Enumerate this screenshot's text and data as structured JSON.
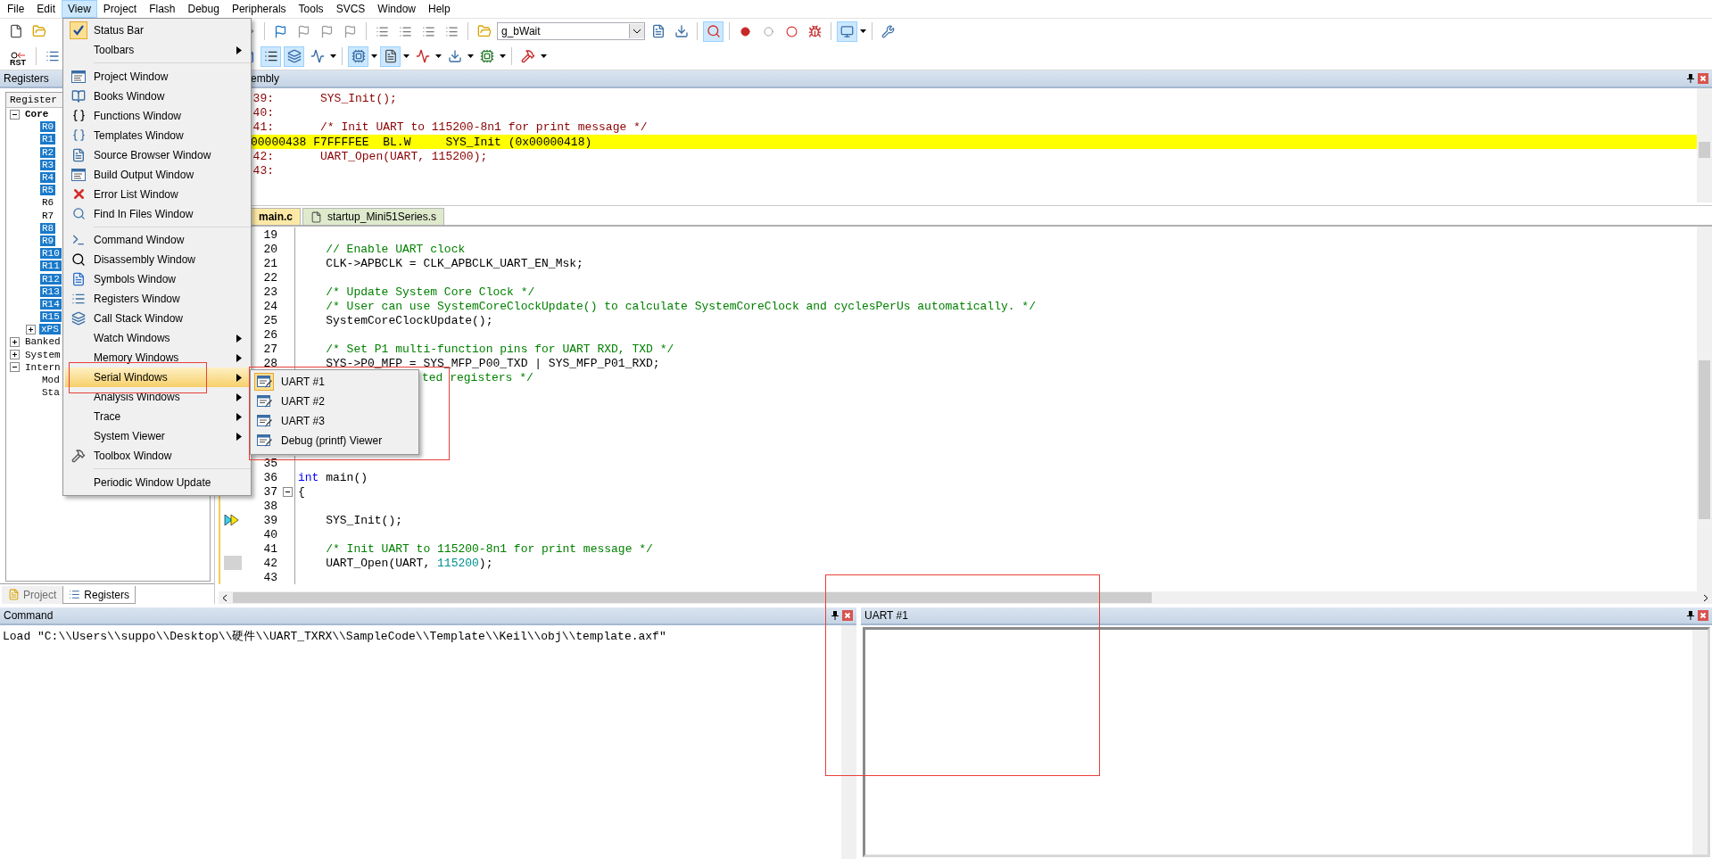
{
  "menubar": [
    {
      "label": "File",
      "selected": false
    },
    {
      "label": "Edit",
      "selected": false
    },
    {
      "label": "View",
      "selected": true
    },
    {
      "label": "Project",
      "selected": false
    },
    {
      "label": "Flash",
      "selected": false
    },
    {
      "label": "Debug",
      "selected": false
    },
    {
      "label": "Peripherals",
      "selected": false
    },
    {
      "label": "Tools",
      "selected": false
    },
    {
      "label": "SVCS",
      "selected": false
    },
    {
      "label": "Window",
      "selected": false
    },
    {
      "label": "Help",
      "selected": false
    }
  ],
  "toolbar": {
    "reset_label": "RST",
    "combo_value": "g_bWait"
  },
  "registers_panel": {
    "title": "Registers",
    "column": "Register",
    "tree": [
      {
        "label": "Core",
        "expanded": true,
        "children": [
          {
            "label": "R0",
            "selected": true
          },
          {
            "label": "R1",
            "selected": true
          },
          {
            "label": "R2",
            "selected": true
          },
          {
            "label": "R3",
            "selected": true
          },
          {
            "label": "R4",
            "selected": true
          },
          {
            "label": "R5",
            "selected": true
          },
          {
            "label": "R6",
            "selected": false
          },
          {
            "label": "R7",
            "selected": false
          },
          {
            "label": "R8",
            "selected": true
          },
          {
            "label": "R9",
            "selected": true
          },
          {
            "label": "R10",
            "selected": true
          },
          {
            "label": "R11",
            "selected": true
          },
          {
            "label": "R12",
            "selected": true
          },
          {
            "label": "R13",
            "selected": true
          },
          {
            "label": "R14",
            "selected": true
          },
          {
            "label": "R15",
            "selected": true
          },
          {
            "label": "xPS",
            "selected": true,
            "expanded": false
          }
        ]
      },
      {
        "label": "Banked",
        "expanded": false
      },
      {
        "label": "System",
        "expanded": false
      },
      {
        "label": "Intern",
        "expanded": true,
        "children": [
          {
            "label": "Mod",
            "selected": false
          },
          {
            "label": "Sta",
            "selected": false
          }
        ]
      }
    ],
    "tabs": [
      {
        "label": "Project",
        "selected": false
      },
      {
        "label": "Registers",
        "selected": true
      }
    ]
  },
  "disassembly": {
    "title": "embly",
    "lines": [
      {
        "kind": "source",
        "number": "39:",
        "text": "SYS_Init();",
        "current": false
      },
      {
        "kind": "source",
        "number": "40:",
        "current": false
      },
      {
        "kind": "source",
        "number": "41:",
        "text": "/* Init UART to 115200-8n1 for print message */",
        "current": false
      },
      {
        "kind": "instruction",
        "text": "00000438 F7FFFFEE  BL.W     SYS_Init (0x00000418)",
        "current": true
      },
      {
        "kind": "source",
        "number": "42:",
        "text": "UART_Open(UART, 115200);",
        "current": false
      },
      {
        "kind": "source",
        "number": "43:",
        "current": false
      }
    ]
  },
  "editor": {
    "tabs": [
      {
        "label": "main.c",
        "selected": true
      },
      {
        "label": "startup_Mini51Series.s",
        "selected": false
      }
    ],
    "lines": [
      {
        "kind": "blank",
        "number": "19"
      },
      {
        "kind": "comment",
        "number": "20",
        "text": "    // Enable UART clock"
      },
      {
        "kind": "code",
        "number": "21",
        "text": "    CLK->APBCLK = CLK_APBCLK_UART_EN_Msk;"
      },
      {
        "kind": "blank",
        "number": "22"
      },
      {
        "kind": "comment",
        "number": "23",
        "text": "    /* Update System Core Clock */"
      },
      {
        "kind": "comment",
        "number": "24",
        "text": "    /* User can use SystemCoreClockUpdate() to calculate SystemCoreClock and cyclesPerUs automatically. */"
      },
      {
        "kind": "code",
        "number": "25",
        "text": "    SystemCoreClockUpdate();"
      },
      {
        "kind": "blank",
        "number": "26"
      },
      {
        "kind": "comment",
        "number": "27",
        "text": "    /* Set P1 multi-function pins for UART RXD, TXD */"
      },
      {
        "kind": "code",
        "number": "28",
        "text": "    SYS->P0_MFP = SYS_MFP_P00_TXD | SYS_MFP_P01_RXD;"
      },
      {
        "kind": "partial",
        "text": "ted registers */"
      },
      {
        "kind": "covered"
      },
      {
        "kind": "covered"
      },
      {
        "kind": "covered"
      },
      {
        "kind": "covered"
      },
      {
        "kind": "covered"
      },
      {
        "kind": "blank",
        "number": "35"
      },
      {
        "kind": "code",
        "number": "36",
        "segments": [
          {
            "kind": "keyword",
            "text": "int"
          },
          {
            "kind": "plain",
            "text": " main()"
          }
        ]
      },
      {
        "kind": "code",
        "number": "37",
        "text": "{",
        "fold": true,
        "current": false,
        "mark": false
      },
      {
        "kind": "blank",
        "number": "38",
        "current": false,
        "mark": false
      },
      {
        "kind": "code",
        "number": "39",
        "text": "    SYS_Init();",
        "current": true,
        "mark": false
      },
      {
        "kind": "blank",
        "number": "40",
        "current": false,
        "mark": false
      },
      {
        "kind": "comment",
        "number": "41",
        "text": "    /* Init UART to 115200-8n1 for print message */",
        "current": false,
        "mark": false
      },
      {
        "kind": "code",
        "number": "42",
        "segments": [
          {
            "kind": "plain",
            "text": "    UART_Open(UART, "
          },
          {
            "kind": "number",
            "text": "115200"
          },
          {
            "kind": "plain",
            "text": ");"
          }
        ],
        "current": false,
        "mark": true
      },
      {
        "kind": "blank",
        "number": "43",
        "current": false,
        "mark": false
      }
    ]
  },
  "command": {
    "title": "Command",
    "text": "Load \"C:\\\\Users\\\\suppo\\\\Desktop\\\\硬件\\\\UART_TXRX\\\\SampleCode\\\\Template\\\\Keil\\\\obj\\\\template.axf\""
  },
  "uart_window": {
    "title": "UART #1"
  },
  "view_menu": {
    "items": [
      {
        "kind": "item",
        "label": "Status Bar",
        "checked": true,
        "selected": false,
        "submenu": false
      },
      {
        "kind": "item",
        "label": "Toolbars",
        "checked": false,
        "selected": false,
        "submenu": true
      },
      {
        "kind": "separator"
      },
      {
        "kind": "item",
        "label": "Project Window",
        "checked": false,
        "selected": false,
        "submenu": false
      },
      {
        "kind": "item",
        "label": "Books Window",
        "checked": false,
        "selected": false,
        "submenu": false
      },
      {
        "kind": "item",
        "label": "Functions Window",
        "checked": false,
        "selected": false,
        "submenu": false
      },
      {
        "kind": "item",
        "label": "Templates Window",
        "checked": false,
        "selected": false,
        "submenu": false
      },
      {
        "kind": "item",
        "label": "Source Browser Window",
        "checked": false,
        "selected": false,
        "submenu": false
      },
      {
        "kind": "item",
        "label": "Build Output Window",
        "checked": false,
        "selected": false,
        "submenu": false
      },
      {
        "kind": "item",
        "label": "Error List Window",
        "checked": false,
        "selected": false,
        "submenu": false
      },
      {
        "kind": "item",
        "label": "Find In Files Window",
        "checked": false,
        "selected": false,
        "submenu": false
      },
      {
        "kind": "separator"
      },
      {
        "kind": "item",
        "label": "Command Window",
        "checked": false,
        "selected": false,
        "submenu": false
      },
      {
        "kind": "item",
        "label": "Disassembly Window",
        "checked": false,
        "selected": false,
        "submenu": false
      },
      {
        "kind": "item",
        "label": "Symbols Window",
        "checked": false,
        "selected": false,
        "submenu": false
      },
      {
        "kind": "item",
        "label": "Registers Window",
        "checked": false,
        "selected": false,
        "submenu": false
      },
      {
        "kind": "item",
        "label": "Call Stack Window",
        "checked": false,
        "selected": false,
        "submenu": false
      },
      {
        "kind": "item",
        "label": "Watch Windows",
        "checked": false,
        "selected": false,
        "submenu": true
      },
      {
        "kind": "item",
        "label": "Memory Windows",
        "checked": false,
        "selected": false,
        "submenu": true
      },
      {
        "kind": "item",
        "label": "Serial Windows",
        "checked": false,
        "selected": true,
        "submenu": true
      },
      {
        "kind": "item",
        "label": "Analysis Windows",
        "checked": false,
        "selected": false,
        "submenu": true
      },
      {
        "kind": "item",
        "label": "Trace",
        "checked": false,
        "selected": false,
        "submenu": true
      },
      {
        "kind": "item",
        "label": "System Viewer",
        "checked": false,
        "selected": false,
        "submenu": true
      },
      {
        "kind": "item",
        "label": "Toolbox Window",
        "checked": false,
        "selected": false,
        "submenu": false
      },
      {
        "kind": "separator"
      },
      {
        "kind": "item",
        "label": "Periodic Window Update",
        "checked": false,
        "selected": false,
        "submenu": false
      }
    ]
  },
  "serial_submenu": {
    "items": [
      {
        "label": "UART #1",
        "selected": true
      },
      {
        "label": "UART #2",
        "selected": false
      },
      {
        "label": "UART #3",
        "selected": false
      },
      {
        "label": "Debug (printf) Viewer",
        "selected": false
      }
    ]
  }
}
